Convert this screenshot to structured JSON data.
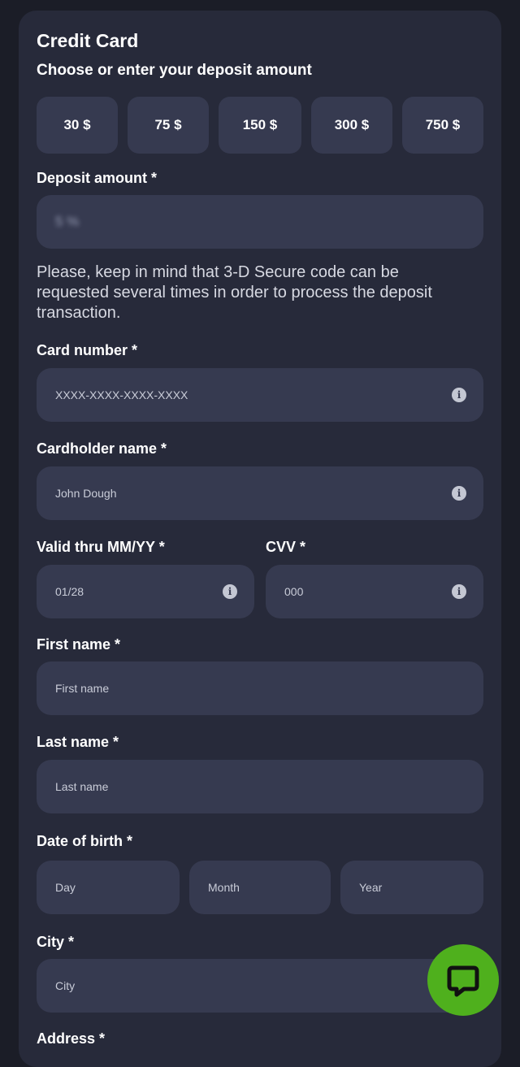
{
  "header": {
    "title": "Credit Card",
    "subtitle": "Choose or enter your deposit amount"
  },
  "amount_chips": [
    "30 $",
    "75 $",
    "150 $",
    "300 $",
    "750 $"
  ],
  "deposit": {
    "label": "Deposit amount *",
    "value": "5 %"
  },
  "note": "Please, keep in mind that 3-D Secure code can be requested several times in order to process the deposit transaction.",
  "card_number": {
    "label": "Card number *",
    "placeholder": "XXXX-XXXX-XXXX-XXXX"
  },
  "cardholder": {
    "label": "Cardholder name *",
    "placeholder": "John Dough"
  },
  "valid_thru": {
    "label": "Valid thru MM/YY *",
    "placeholder": "01/28"
  },
  "cvv": {
    "label": "CVV *",
    "placeholder": "000"
  },
  "first_name": {
    "label": "First name *",
    "placeholder": "First name"
  },
  "last_name": {
    "label": "Last name *",
    "placeholder": "Last name"
  },
  "dob": {
    "label": "Date of birth *",
    "day": "Day",
    "month": "Month",
    "year": "Year"
  },
  "city": {
    "label": "City *",
    "placeholder": "City"
  },
  "address": {
    "label": "Address *"
  },
  "icons": {
    "info": "info-icon",
    "chat": "chat-bubble-icon"
  },
  "colors": {
    "chat_button": "#4fb01d",
    "panel": "#272a3a",
    "field": "#363a50"
  }
}
